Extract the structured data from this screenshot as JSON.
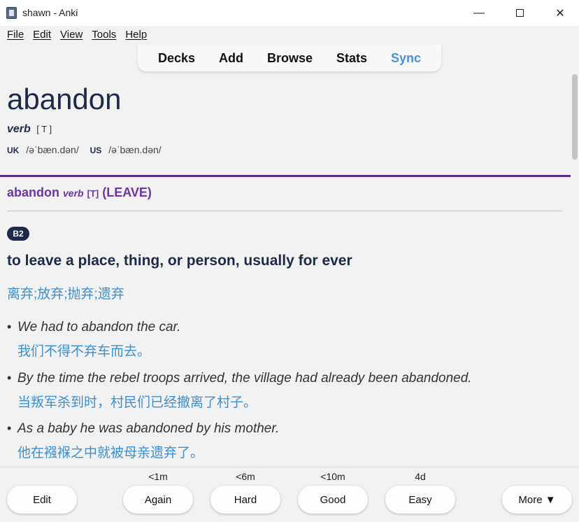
{
  "window": {
    "title": "shawn - Anki",
    "minimize_glyph": "—",
    "close_glyph": "✕"
  },
  "menu": [
    "File",
    "Edit",
    "View",
    "Tools",
    "Help"
  ],
  "toolbar": {
    "items": [
      "Decks",
      "Add",
      "Browse",
      "Stats",
      "Sync"
    ],
    "sync_color": "#4a8fe0"
  },
  "card": {
    "headword": "abandon",
    "pos": "verb",
    "grammar": "[ T ]",
    "uk_label": "UK",
    "uk_ipa": "/əˈbæn.dən/",
    "us_label": "US",
    "us_ipa": "/əˈbæn.dən/",
    "sense_word": "abandon",
    "sense_pos": "verb",
    "sense_grammar": "[T]",
    "sense_guide": "(LEAVE)",
    "level": "B2",
    "definition": "to leave a place, thing, or person, usually for ever",
    "translation": "离弃;放弃;抛弃;遗弃",
    "examples": [
      {
        "en": "We had to abandon the car.",
        "zh": "我们不得不弃车而去。"
      },
      {
        "en": "By the time the rebel troops arrived, the village had already been abandoned.",
        "zh": "当叛军杀到时，村民们已经撤离了村子。"
      },
      {
        "en": "As a baby he was abandoned by his mother.",
        "zh": "他在襁褓之中就被母亲遗弃了。"
      }
    ],
    "colors": {
      "headword": "#1e2a4a",
      "sense": "#6c34a8",
      "translation": "#3a8fd6",
      "rule": "#5b2c91"
    }
  },
  "bottom": {
    "edit": "Edit",
    "answers": [
      {
        "label": "Again",
        "timing": "<1m"
      },
      {
        "label": "Hard",
        "timing": "<6m"
      },
      {
        "label": "Good",
        "timing": "<10m"
      },
      {
        "label": "Easy",
        "timing": "4d"
      }
    ],
    "more": "More ▼"
  }
}
